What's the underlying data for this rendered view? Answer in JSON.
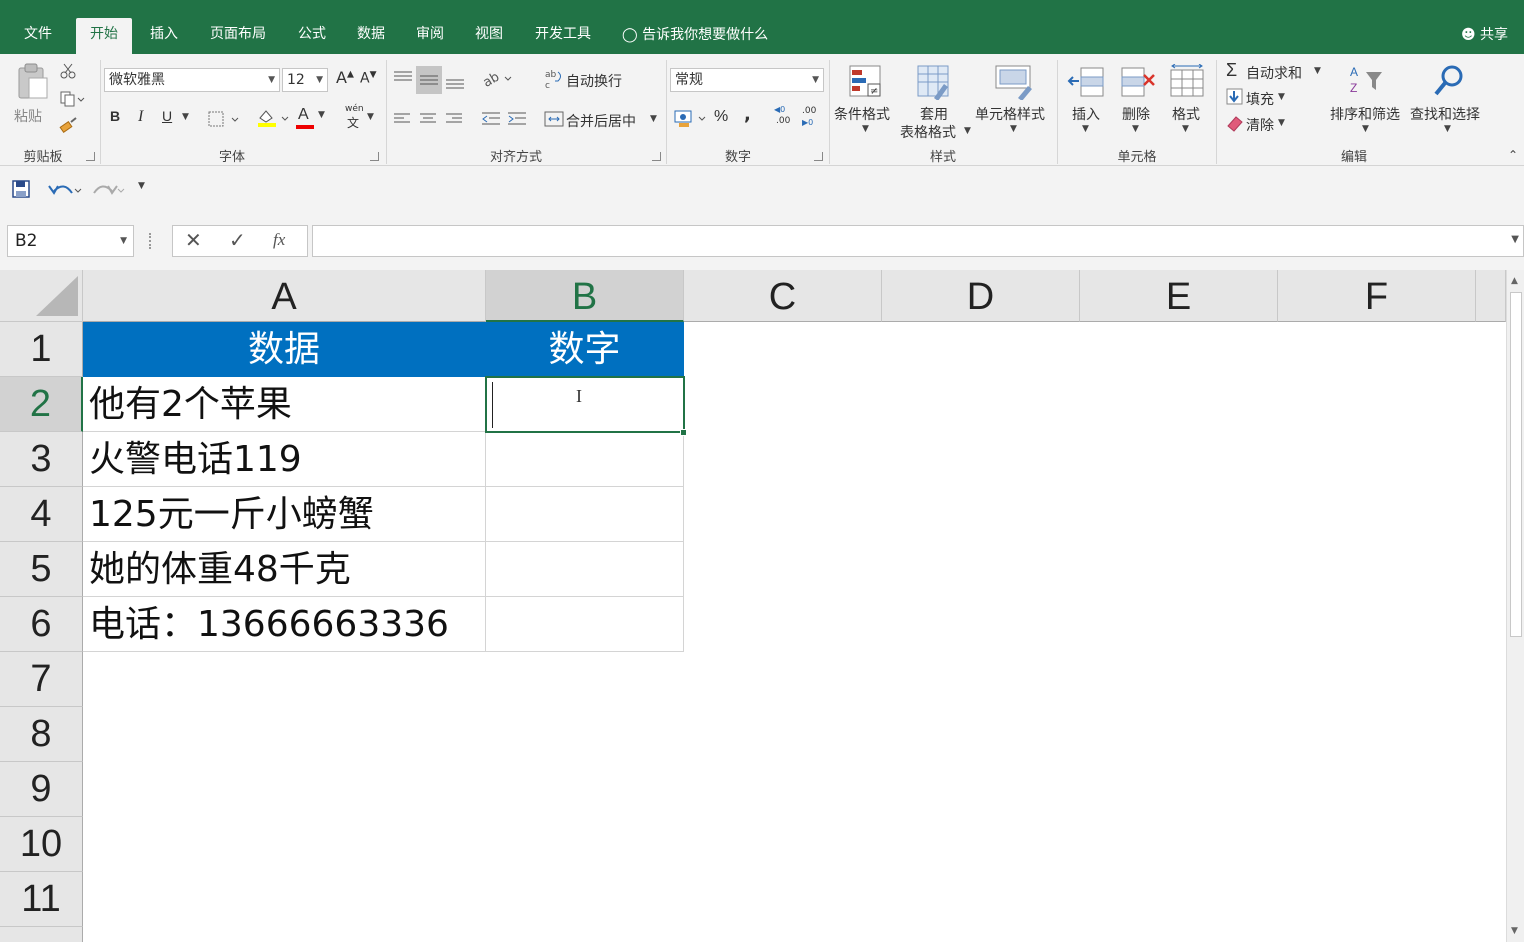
{
  "tabs": [
    {
      "label": "文件",
      "active": false
    },
    {
      "label": "开始",
      "active": true
    },
    {
      "label": "插入",
      "active": false
    },
    {
      "label": "页面布局",
      "active": false
    },
    {
      "label": "公式",
      "active": false
    },
    {
      "label": "数据",
      "active": false
    },
    {
      "label": "审阅",
      "active": false
    },
    {
      "label": "视图",
      "active": false
    },
    {
      "label": "开发工具",
      "active": false
    }
  ],
  "tell_me": "告诉我你想要做什么",
  "share": "共享",
  "ribbon": {
    "clipboard": {
      "paste": "粘贴",
      "group": "剪贴板"
    },
    "font": {
      "name": "微软雅黑",
      "size": "12",
      "bold": "B",
      "italic": "I",
      "underline": "U",
      "grow": "A",
      "shrink": "A",
      "font_color": "A",
      "phonetic": "wén",
      "phonetic_char": "文",
      "group": "字体"
    },
    "alignment": {
      "wrap": "自动换行",
      "merge": "合并后居中",
      "group": "对齐方式"
    },
    "number": {
      "format": "常规",
      "percent": "%",
      "comma": ",",
      "inc": ".00",
      "dec": ".00",
      "group": "数字"
    },
    "styles": {
      "conditional": "条件格式",
      "table_line1": "套用",
      "table_line2": "表格格式",
      "cell_styles": "单元格样式",
      "group": "样式"
    },
    "cells": {
      "insert": "插入",
      "delete": "删除",
      "format": "格式",
      "group": "单元格"
    },
    "editing": {
      "autosum": "自动求和",
      "fill": "填充",
      "clear": "清除",
      "sort": "排序和筛选",
      "find": "查找和选择",
      "group": "编辑"
    }
  },
  "formula_bar": {
    "name_box": "B2",
    "value": "",
    "fx": "fx"
  },
  "columns": [
    "A",
    "B",
    "C",
    "D",
    "E",
    "F"
  ],
  "selected_column": "B",
  "rows": [
    "1",
    "2",
    "3",
    "4",
    "5",
    "6",
    "7",
    "8",
    "9",
    "10",
    "11"
  ],
  "selected_row": "2",
  "cells": {
    "A1": "数据",
    "B1": "数字",
    "A2": "他有2个苹果",
    "A3": "火警电话119",
    "A4": "125元一斤小螃蟹",
    "A5": "她的体重48千克",
    "A6": "电话：13666663336"
  },
  "colors": {
    "accent": "#217346",
    "header_fill": "#0070c0"
  }
}
